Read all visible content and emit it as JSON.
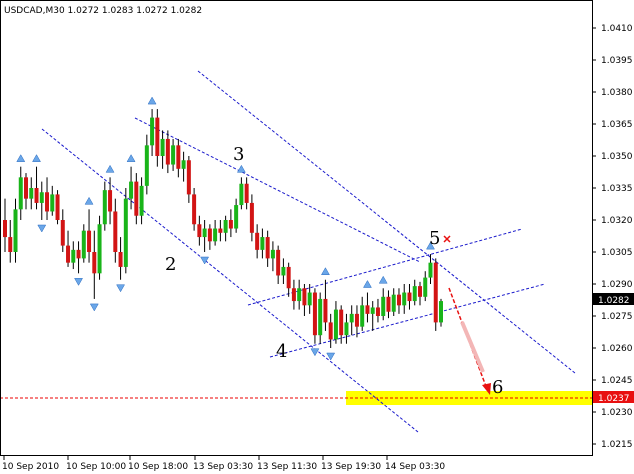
{
  "symbol_header": "USDCAD,M30  1.0272 1.0283 1.0272 1.0282",
  "colors": {
    "bull": "#19b419",
    "bear": "#d21414",
    "wick": "#000000",
    "fractal": "#6aa6e8",
    "channel": "#1a1acc",
    "target_zone": "#ffff00",
    "target_line": "#ee0000",
    "arrow": "#e81010",
    "cross": "#e81010"
  },
  "wave_labels": [
    "2",
    "3",
    "4",
    "5",
    "6"
  ],
  "current_price_label": "1.0282",
  "target_price_label": "1.0237",
  "chart_data": {
    "type": "candlestick",
    "title": "USDCAD,M30  1.0272 1.0283 1.0272 1.0282",
    "ylim": [
      1.0213,
      1.0418
    ],
    "y_ticks": [
      "1.0410",
      "1.0395",
      "1.0380",
      "1.0365",
      "1.0350",
      "1.0335",
      "1.0320",
      "1.0305",
      "1.0290",
      "1.0275",
      "1.0260",
      "1.0245",
      "1.0230",
      "1.0215"
    ],
    "x_ticks": [
      "10 Sep 2010",
      "10 Sep 10:00",
      "10 Sep 18:00",
      "13 Sep 03:30",
      "13 Sep 11:30",
      "13 Sep 19:30",
      "14 Sep 03:30"
    ],
    "current_price": 1.0282,
    "target_price": 1.0237,
    "candles": [
      [
        1.032,
        1.033,
        1.0305,
        1.0312
      ],
      [
        1.0312,
        1.032,
        1.03,
        1.0305
      ],
      [
        1.0305,
        1.033,
        1.03,
        1.0325
      ],
      [
        1.0325,
        1.0345,
        1.032,
        1.034
      ],
      [
        1.034,
        1.0342,
        1.0325,
        1.033
      ],
      [
        1.033,
        1.034,
        1.0325,
        1.0335
      ],
      [
        1.0335,
        1.0345,
        1.0325,
        1.0328
      ],
      [
        1.0328,
        1.0338,
        1.032,
        1.0333
      ],
      [
        1.0333,
        1.034,
        1.032,
        1.0324
      ],
      [
        1.0324,
        1.0336,
        1.0322,
        1.0332
      ],
      [
        1.0332,
        1.0334,
        1.0318,
        1.032
      ],
      [
        1.032,
        1.0325,
        1.0305,
        1.0308
      ],
      [
        1.0308,
        1.0315,
        1.0298,
        1.03
      ],
      [
        1.03,
        1.031,
        1.0297,
        1.0306
      ],
      [
        1.0306,
        1.031,
        1.0295,
        1.0302
      ],
      [
        1.0302,
        1.0318,
        1.03,
        1.0315
      ],
      [
        1.0315,
        1.0325,
        1.03,
        1.0305
      ],
      [
        1.0305,
        1.0315,
        1.0283,
        1.0295
      ],
      [
        1.0295,
        1.0322,
        1.0292,
        1.0318
      ],
      [
        1.0318,
        1.0338,
        1.0315,
        1.0334
      ],
      [
        1.0334,
        1.034,
        1.0318,
        1.0324
      ],
      [
        1.0324,
        1.033,
        1.03,
        1.0305
      ],
      [
        1.0305,
        1.0312,
        1.0292,
        1.0298
      ],
      [
        1.0298,
        1.0335,
        1.0295,
        1.033
      ],
      [
        1.033,
        1.0345,
        1.0325,
        1.0338
      ],
      [
        1.0338,
        1.0342,
        1.0318,
        1.0322
      ],
      [
        1.0322,
        1.034,
        1.0318,
        1.0336
      ],
      [
        1.0336,
        1.036,
        1.0332,
        1.0355
      ],
      [
        1.0355,
        1.0372,
        1.035,
        1.0368
      ],
      [
        1.0368,
        1.0372,
        1.0345,
        1.035
      ],
      [
        1.035,
        1.0362,
        1.0344,
        1.0358
      ],
      [
        1.0358,
        1.0362,
        1.0342,
        1.0346
      ],
      [
        1.0346,
        1.0358,
        1.0343,
        1.0355
      ],
      [
        1.0355,
        1.0358,
        1.034,
        1.0344
      ],
      [
        1.0344,
        1.0352,
        1.0338,
        1.0348
      ],
      [
        1.0348,
        1.035,
        1.0328,
        1.0332
      ],
      [
        1.0332,
        1.0335,
        1.0315,
        1.0318
      ],
      [
        1.0318,
        1.0322,
        1.0308,
        1.0312
      ],
      [
        1.0312,
        1.032,
        1.0305,
        1.0316
      ],
      [
        1.0316,
        1.0318,
        1.0306,
        1.031
      ],
      [
        1.031,
        1.032,
        1.0308,
        1.0316
      ],
      [
        1.0316,
        1.032,
        1.031,
        1.0314
      ],
      [
        1.0314,
        1.0322,
        1.031,
        1.032
      ],
      [
        1.032,
        1.0325,
        1.0312,
        1.0316
      ],
      [
        1.0316,
        1.033,
        1.0314,
        1.0327
      ],
      [
        1.0327,
        1.034,
        1.0325,
        1.0337
      ],
      [
        1.0337,
        1.034,
        1.0325,
        1.0328
      ],
      [
        1.0328,
        1.0332,
        1.031,
        1.0314
      ],
      [
        1.0314,
        1.0318,
        1.0302,
        1.0306
      ],
      [
        1.0306,
        1.0316,
        1.0302,
        1.0312
      ],
      [
        1.0312,
        1.0315,
        1.0298,
        1.0302
      ],
      [
        1.0302,
        1.031,
        1.0296,
        1.0306
      ],
      [
        1.0306,
        1.0308,
        1.029,
        1.0294
      ],
      [
        1.0294,
        1.0302,
        1.029,
        1.0298
      ],
      [
        1.0298,
        1.03,
        1.0284,
        1.0288
      ],
      [
        1.0288,
        1.0292,
        1.0278,
        1.0282
      ],
      [
        1.0282,
        1.0292,
        1.0278,
        1.0288
      ],
      [
        1.0288,
        1.029,
        1.0275,
        1.028
      ],
      [
        1.028,
        1.029,
        1.0276,
        1.0286
      ],
      [
        1.0286,
        1.0288,
        1.0262,
        1.0266
      ],
      [
        1.0266,
        1.0286,
        1.0262,
        1.0283
      ],
      [
        1.0283,
        1.0292,
        1.0268,
        1.0272
      ],
      [
        1.0272,
        1.0276,
        1.026,
        1.0264
      ],
      [
        1.0264,
        1.0282,
        1.0262,
        1.0278
      ],
      [
        1.0278,
        1.028,
        1.0262,
        1.0266
      ],
      [
        1.0266,
        1.0276,
        1.0262,
        1.0272
      ],
      [
        1.0272,
        1.028,
        1.0266,
        1.0276
      ],
      [
        1.0276,
        1.028,
        1.0265,
        1.027
      ],
      [
        1.027,
        1.0284,
        1.0268,
        1.028
      ],
      [
        1.028,
        1.0286,
        1.0272,
        1.0276
      ],
      [
        1.0276,
        1.0282,
        1.0268,
        1.0279
      ],
      [
        1.0279,
        1.0283,
        1.0272,
        1.0275
      ],
      [
        1.0275,
        1.0288,
        1.0273,
        1.0284
      ],
      [
        1.0284,
        1.0287,
        1.0274,
        1.0277
      ],
      [
        1.0277,
        1.0288,
        1.0275,
        1.0285
      ],
      [
        1.0285,
        1.0288,
        1.0276,
        1.028
      ],
      [
        1.028,
        1.029,
        1.0276,
        1.0286
      ],
      [
        1.0286,
        1.029,
        1.0278,
        1.0282
      ],
      [
        1.0282,
        1.0292,
        1.028,
        1.0289
      ],
      [
        1.0289,
        1.0291,
        1.028,
        1.0284
      ],
      [
        1.0284,
        1.0296,
        1.0282,
        1.0293
      ],
      [
        1.0293,
        1.0304,
        1.029,
        1.03
      ],
      [
        1.03,
        1.0302,
        1.0268,
        1.0272
      ],
      [
        1.0272,
        1.0283,
        1.027,
        1.0282
      ]
    ]
  }
}
